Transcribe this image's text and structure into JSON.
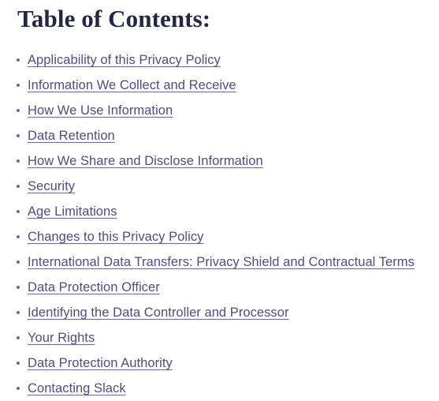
{
  "page": {
    "background_color": "#ffffff",
    "heading_color": "#232746",
    "link_color": "#4d4d84",
    "bullet_color": "#6d6d8c"
  },
  "toc": {
    "heading": "Table of Contents:",
    "items": [
      {
        "label": "Applicability of this Privacy Policy"
      },
      {
        "label": "Information We Collect and Receive"
      },
      {
        "label": "How We Use Information"
      },
      {
        "label": "Data Retention"
      },
      {
        "label": "How We Share and Disclose Information"
      },
      {
        "label": "Security"
      },
      {
        "label": "Age Limitations"
      },
      {
        "label": "Changes to this Privacy Policy"
      },
      {
        "label": "International Data Transfers: Privacy Shield and Contractual Terms"
      },
      {
        "label": "Data Protection Officer"
      },
      {
        "label": "Identifying the Data Controller and Processor"
      },
      {
        "label": "Your Rights"
      },
      {
        "label": "Data Protection Authority"
      },
      {
        "label": "Contacting Slack"
      }
    ]
  }
}
